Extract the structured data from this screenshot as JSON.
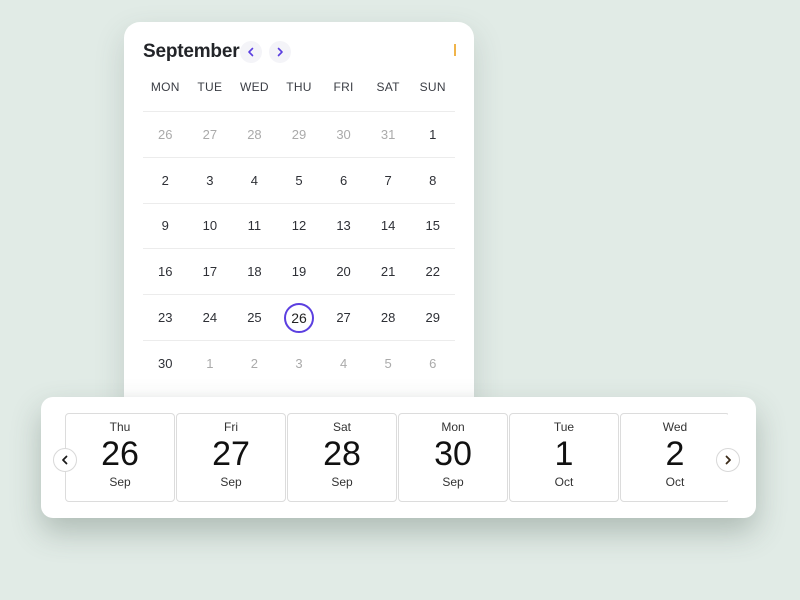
{
  "calendar": {
    "month_title": "September",
    "prev_icon": "chevron-left-icon",
    "next_icon": "chevron-right-icon",
    "accent_color": "#5b3fe0",
    "weekdays": [
      "MON",
      "TUE",
      "WED",
      "THU",
      "FRI",
      "SAT",
      "SUN"
    ],
    "weeks": [
      [
        {
          "d": "26",
          "muted": true
        },
        {
          "d": "27",
          "muted": true
        },
        {
          "d": "28",
          "muted": true
        },
        {
          "d": "29",
          "muted": true
        },
        {
          "d": "30",
          "muted": true
        },
        {
          "d": "31",
          "muted": true
        },
        {
          "d": "1",
          "muted": false
        }
      ],
      [
        {
          "d": "2",
          "muted": false
        },
        {
          "d": "3",
          "muted": false
        },
        {
          "d": "4",
          "muted": false
        },
        {
          "d": "5",
          "muted": false
        },
        {
          "d": "6",
          "muted": false
        },
        {
          "d": "7",
          "muted": false
        },
        {
          "d": "8",
          "muted": false
        }
      ],
      [
        {
          "d": "9",
          "muted": false
        },
        {
          "d": "10",
          "muted": false
        },
        {
          "d": "11",
          "muted": false
        },
        {
          "d": "12",
          "muted": false
        },
        {
          "d": "13",
          "muted": false
        },
        {
          "d": "14",
          "muted": false
        },
        {
          "d": "15",
          "muted": false
        }
      ],
      [
        {
          "d": "16",
          "muted": false
        },
        {
          "d": "17",
          "muted": false
        },
        {
          "d": "18",
          "muted": false
        },
        {
          "d": "19",
          "muted": false
        },
        {
          "d": "20",
          "muted": false
        },
        {
          "d": "21",
          "muted": false
        },
        {
          "d": "22",
          "muted": false
        }
      ],
      [
        {
          "d": "23",
          "muted": false
        },
        {
          "d": "24",
          "muted": false
        },
        {
          "d": "25",
          "muted": false
        },
        {
          "d": "26",
          "muted": false,
          "today": true
        },
        {
          "d": "27",
          "muted": false
        },
        {
          "d": "28",
          "muted": false
        },
        {
          "d": "29",
          "muted": false
        }
      ],
      [
        {
          "d": "30",
          "muted": false
        },
        {
          "d": "1",
          "muted": true
        },
        {
          "d": "2",
          "muted": true
        },
        {
          "d": "3",
          "muted": true
        },
        {
          "d": "4",
          "muted": true
        },
        {
          "d": "5",
          "muted": true
        },
        {
          "d": "6",
          "muted": true
        }
      ]
    ]
  },
  "date_strip": {
    "prev_icon": "chevron-left-icon",
    "next_icon": "chevron-right-icon",
    "tiles": [
      {
        "dow": "Thu",
        "day": "26",
        "month": "Sep"
      },
      {
        "dow": "Fri",
        "day": "27",
        "month": "Sep"
      },
      {
        "dow": "Sat",
        "day": "28",
        "month": "Sep"
      },
      {
        "dow": "Mon",
        "day": "30",
        "month": "Sep"
      },
      {
        "dow": "Tue",
        "day": "1",
        "month": "Oct"
      },
      {
        "dow": "Wed",
        "day": "2",
        "month": "Oct"
      }
    ]
  }
}
